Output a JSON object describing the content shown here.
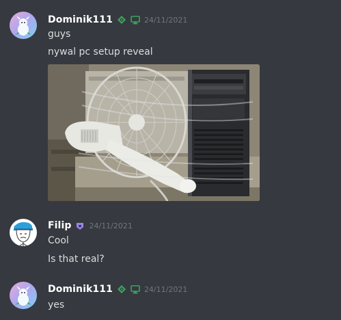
{
  "colors": {
    "background": "#36393f",
    "username": "#ffffff",
    "message_text": "#dcddde",
    "timestamp": "#72767d",
    "booster_badge": "#3ba55c",
    "desktop_badge": "#3ba55c",
    "nitro_badge": "#9b84ee"
  },
  "messages": [
    {
      "author": "Dominik111",
      "timestamp": "24/11/2021",
      "badges": [
        "diamond-badge-icon",
        "desktop-icon"
      ],
      "lines": [
        "guys",
        "nywal pc setup reveal"
      ],
      "attachment": "image"
    },
    {
      "author": "Filip",
      "timestamp": "24/11/2021",
      "badges": [
        "nitro-badge-icon"
      ],
      "lines": [
        "Cool",
        "Is that real?"
      ]
    },
    {
      "author": "Dominik111",
      "timestamp": "24/11/2021",
      "badges": [
        "diamond-badge-icon",
        "desktop-icon"
      ],
      "lines": [
        "yes"
      ]
    }
  ]
}
